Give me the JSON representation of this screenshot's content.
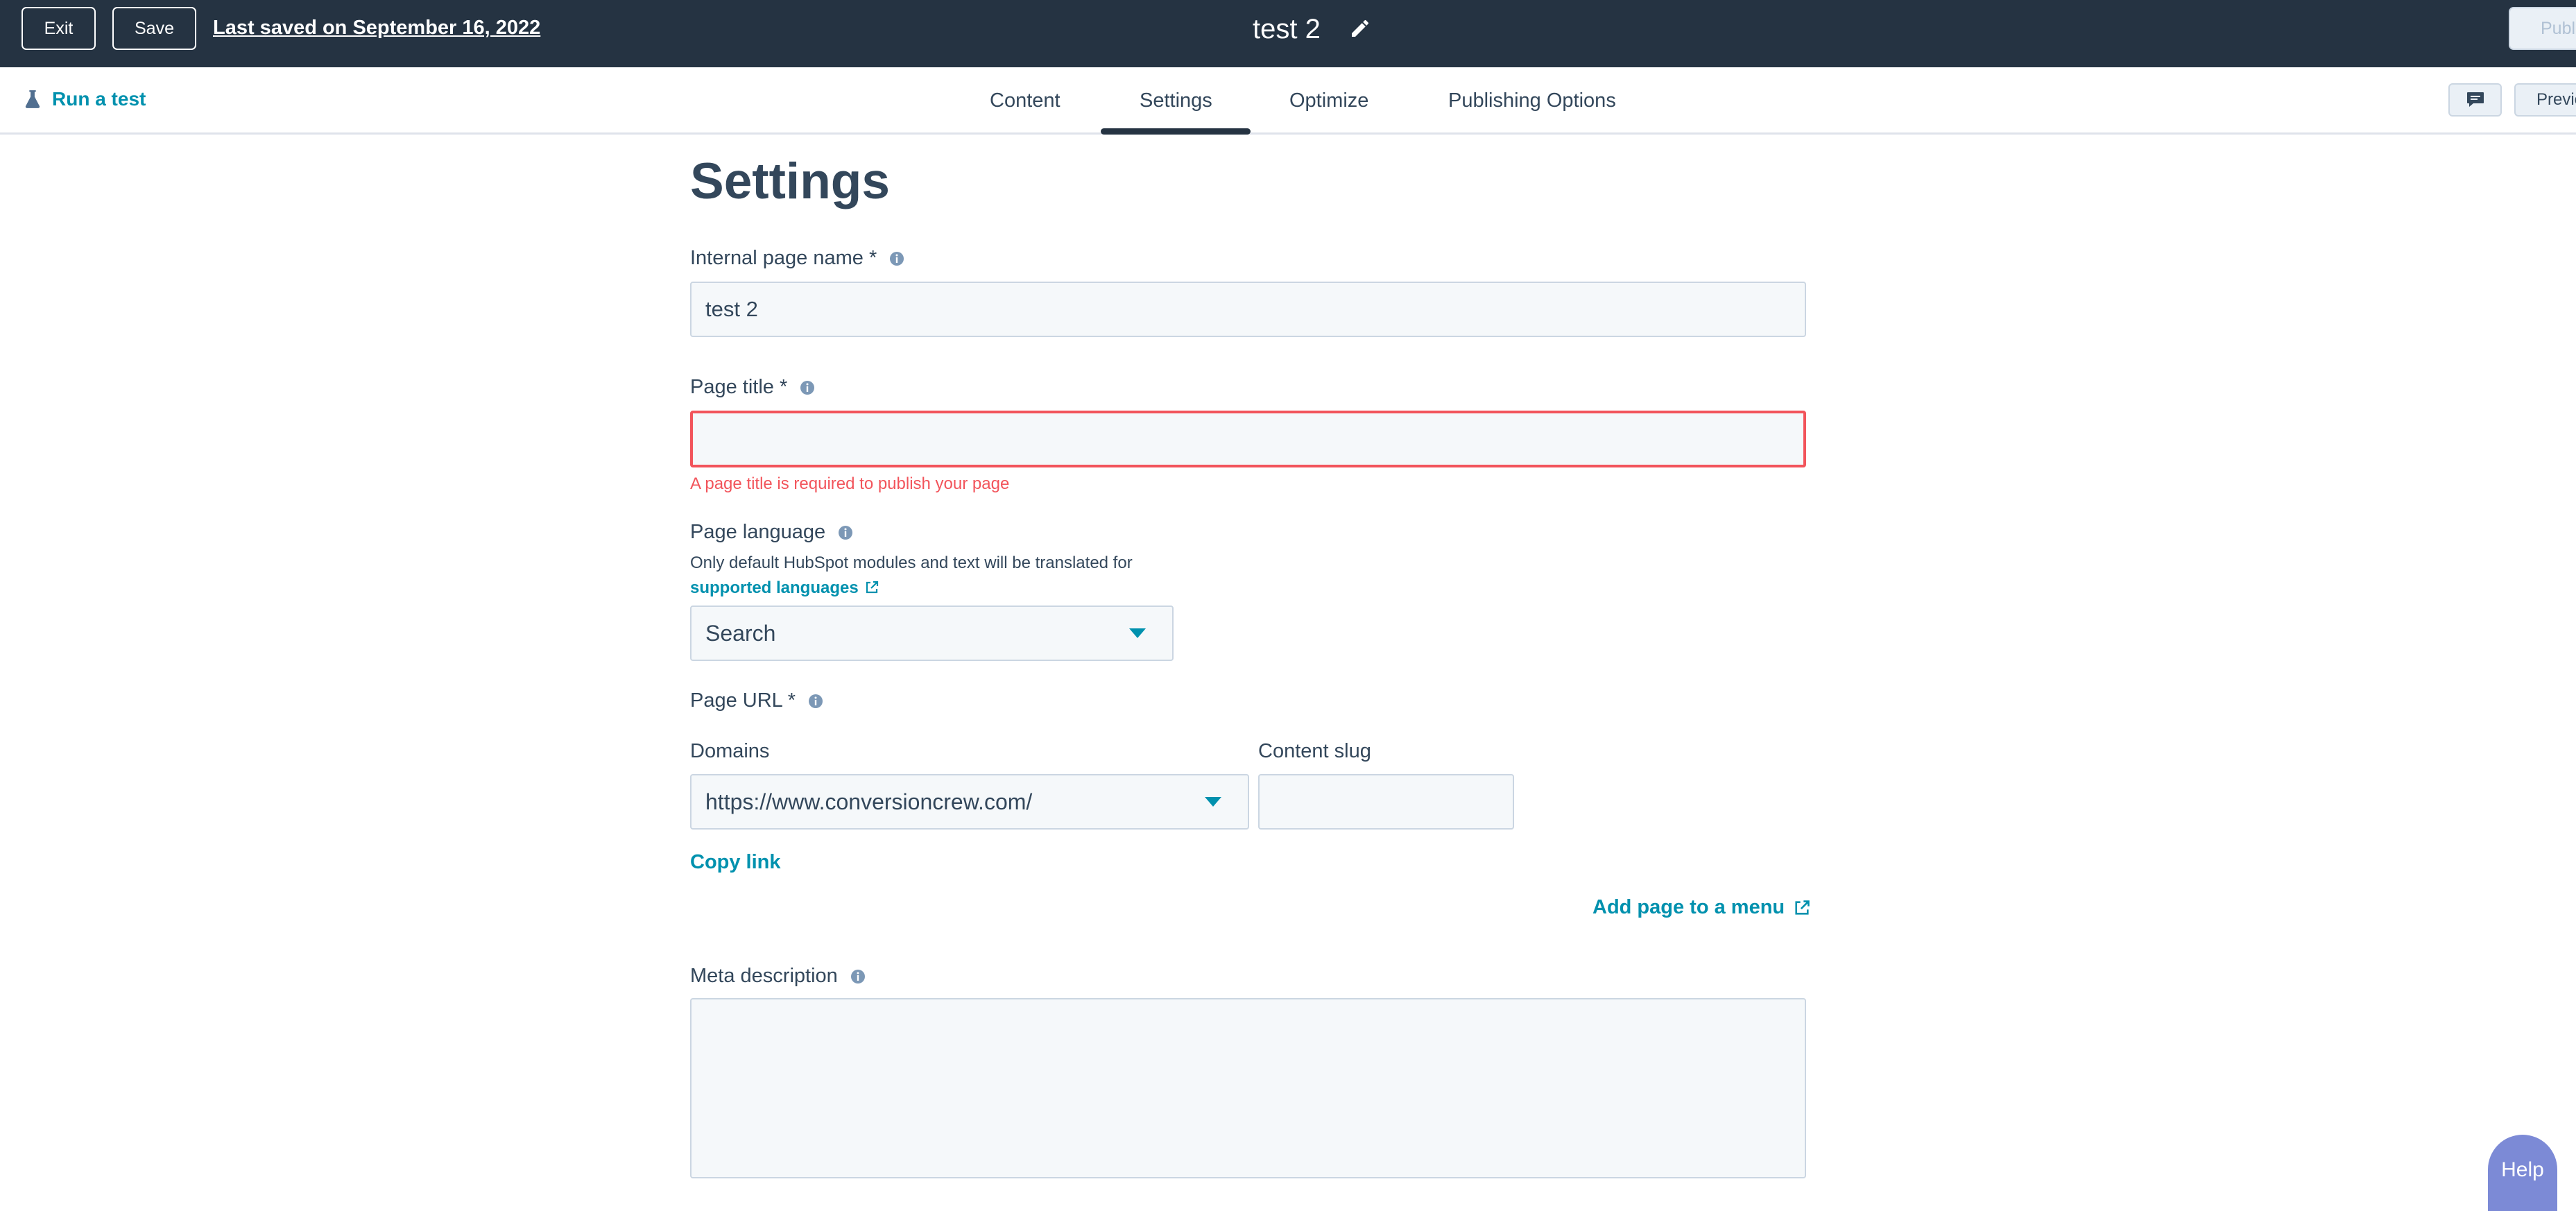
{
  "topbar": {
    "exit_label": "Exit",
    "save_label": "Save",
    "last_saved": "Last saved on September 16, 2022",
    "page_name": "test 2",
    "publish_label": "Publish"
  },
  "tabbar": {
    "run_test": "Run a test",
    "tabs": [
      "Content",
      "Settings",
      "Optimize",
      "Publishing Options"
    ],
    "active_tab": "Settings",
    "preview_label": "Preview"
  },
  "settings": {
    "heading": "Settings",
    "internal_name": {
      "label": "Internal page name *",
      "value": "test 2"
    },
    "page_title": {
      "label": "Page title *",
      "value": "",
      "error": "A page title is required to publish your page"
    },
    "page_language": {
      "label": "Page language",
      "help_text": "Only default HubSpot modules and text will be translated for",
      "help_link": "supported languages",
      "placeholder": "Search"
    },
    "page_url": {
      "label": "Page URL *",
      "domains_label": "Domains",
      "domain_value": "https://www.conversioncrew.com/",
      "slug_label": "Content slug",
      "slug_value": "",
      "copy_link": "Copy link",
      "add_to_menu": "Add page to a menu"
    },
    "meta_description": {
      "label": "Meta description",
      "value": ""
    }
  },
  "help_button": "Help",
  "colors": {
    "topbar_bg": "#253342",
    "accent": "#0091ae",
    "error": "#f2545b",
    "field_bg": "#f5f8fa",
    "help_bg": "#7c8ad6"
  },
  "icons": [
    "pencil-icon",
    "flask-icon",
    "comment-icon",
    "info-icon",
    "external-link-icon",
    "caret-down-icon"
  ]
}
